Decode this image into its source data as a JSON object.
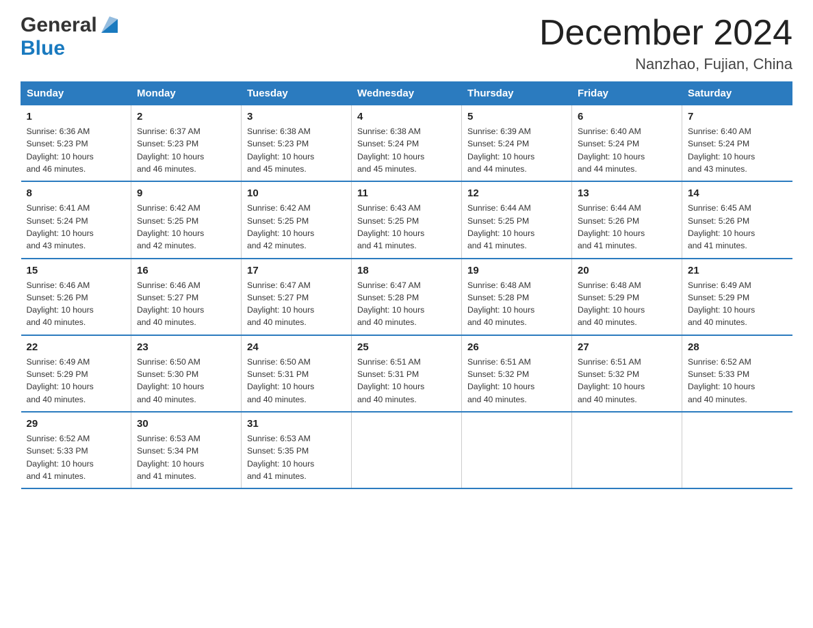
{
  "header": {
    "logo_text_general": "General",
    "logo_text_blue": "Blue",
    "month_title": "December 2024",
    "location": "Nanzhao, Fujian, China"
  },
  "days_of_week": [
    "Sunday",
    "Monday",
    "Tuesday",
    "Wednesday",
    "Thursday",
    "Friday",
    "Saturday"
  ],
  "weeks": [
    [
      {
        "day": "1",
        "sunrise": "6:36 AM",
        "sunset": "5:23 PM",
        "daylight": "10 hours and 46 minutes."
      },
      {
        "day": "2",
        "sunrise": "6:37 AM",
        "sunset": "5:23 PM",
        "daylight": "10 hours and 46 minutes."
      },
      {
        "day": "3",
        "sunrise": "6:38 AM",
        "sunset": "5:23 PM",
        "daylight": "10 hours and 45 minutes."
      },
      {
        "day": "4",
        "sunrise": "6:38 AM",
        "sunset": "5:24 PM",
        "daylight": "10 hours and 45 minutes."
      },
      {
        "day": "5",
        "sunrise": "6:39 AM",
        "sunset": "5:24 PM",
        "daylight": "10 hours and 44 minutes."
      },
      {
        "day": "6",
        "sunrise": "6:40 AM",
        "sunset": "5:24 PM",
        "daylight": "10 hours and 44 minutes."
      },
      {
        "day": "7",
        "sunrise": "6:40 AM",
        "sunset": "5:24 PM",
        "daylight": "10 hours and 43 minutes."
      }
    ],
    [
      {
        "day": "8",
        "sunrise": "6:41 AM",
        "sunset": "5:24 PM",
        "daylight": "10 hours and 43 minutes."
      },
      {
        "day": "9",
        "sunrise": "6:42 AM",
        "sunset": "5:25 PM",
        "daylight": "10 hours and 42 minutes."
      },
      {
        "day": "10",
        "sunrise": "6:42 AM",
        "sunset": "5:25 PM",
        "daylight": "10 hours and 42 minutes."
      },
      {
        "day": "11",
        "sunrise": "6:43 AM",
        "sunset": "5:25 PM",
        "daylight": "10 hours and 41 minutes."
      },
      {
        "day": "12",
        "sunrise": "6:44 AM",
        "sunset": "5:25 PM",
        "daylight": "10 hours and 41 minutes."
      },
      {
        "day": "13",
        "sunrise": "6:44 AM",
        "sunset": "5:26 PM",
        "daylight": "10 hours and 41 minutes."
      },
      {
        "day": "14",
        "sunrise": "6:45 AM",
        "sunset": "5:26 PM",
        "daylight": "10 hours and 41 minutes."
      }
    ],
    [
      {
        "day": "15",
        "sunrise": "6:46 AM",
        "sunset": "5:26 PM",
        "daylight": "10 hours and 40 minutes."
      },
      {
        "day": "16",
        "sunrise": "6:46 AM",
        "sunset": "5:27 PM",
        "daylight": "10 hours and 40 minutes."
      },
      {
        "day": "17",
        "sunrise": "6:47 AM",
        "sunset": "5:27 PM",
        "daylight": "10 hours and 40 minutes."
      },
      {
        "day": "18",
        "sunrise": "6:47 AM",
        "sunset": "5:28 PM",
        "daylight": "10 hours and 40 minutes."
      },
      {
        "day": "19",
        "sunrise": "6:48 AM",
        "sunset": "5:28 PM",
        "daylight": "10 hours and 40 minutes."
      },
      {
        "day": "20",
        "sunrise": "6:48 AM",
        "sunset": "5:29 PM",
        "daylight": "10 hours and 40 minutes."
      },
      {
        "day": "21",
        "sunrise": "6:49 AM",
        "sunset": "5:29 PM",
        "daylight": "10 hours and 40 minutes."
      }
    ],
    [
      {
        "day": "22",
        "sunrise": "6:49 AM",
        "sunset": "5:29 PM",
        "daylight": "10 hours and 40 minutes."
      },
      {
        "day": "23",
        "sunrise": "6:50 AM",
        "sunset": "5:30 PM",
        "daylight": "10 hours and 40 minutes."
      },
      {
        "day": "24",
        "sunrise": "6:50 AM",
        "sunset": "5:31 PM",
        "daylight": "10 hours and 40 minutes."
      },
      {
        "day": "25",
        "sunrise": "6:51 AM",
        "sunset": "5:31 PM",
        "daylight": "10 hours and 40 minutes."
      },
      {
        "day": "26",
        "sunrise": "6:51 AM",
        "sunset": "5:32 PM",
        "daylight": "10 hours and 40 minutes."
      },
      {
        "day": "27",
        "sunrise": "6:51 AM",
        "sunset": "5:32 PM",
        "daylight": "10 hours and 40 minutes."
      },
      {
        "day": "28",
        "sunrise": "6:52 AM",
        "sunset": "5:33 PM",
        "daylight": "10 hours and 40 minutes."
      }
    ],
    [
      {
        "day": "29",
        "sunrise": "6:52 AM",
        "sunset": "5:33 PM",
        "daylight": "10 hours and 41 minutes."
      },
      {
        "day": "30",
        "sunrise": "6:53 AM",
        "sunset": "5:34 PM",
        "daylight": "10 hours and 41 minutes."
      },
      {
        "day": "31",
        "sunrise": "6:53 AM",
        "sunset": "5:35 PM",
        "daylight": "10 hours and 41 minutes."
      },
      null,
      null,
      null,
      null
    ]
  ],
  "labels": {
    "sunrise": "Sunrise:",
    "sunset": "Sunset:",
    "daylight": "Daylight:"
  },
  "colors": {
    "header_bg": "#2b7bbf",
    "border": "#2b7bbf",
    "logo_blue": "#1a7abf"
  }
}
